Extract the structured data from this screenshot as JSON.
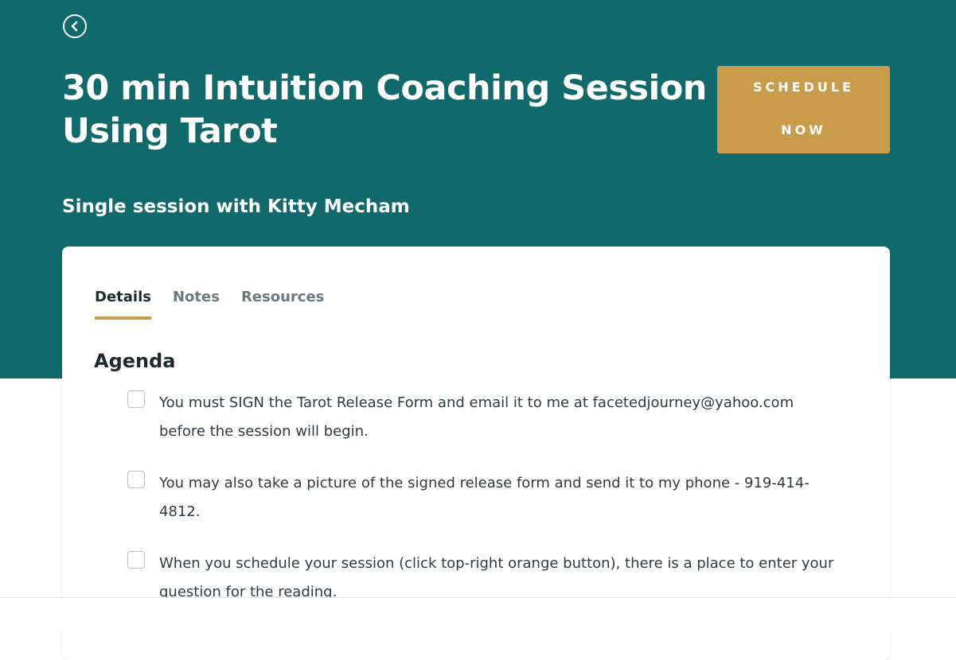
{
  "header": {
    "back_icon": "chevron-left-circle-icon",
    "title": "30 min Intuition Coaching Session Using Tarot",
    "schedule_button": {
      "line1": "SCHEDULE",
      "line2": "NOW"
    },
    "subtitle": "Single session with Kitty Mecham"
  },
  "tabs": [
    {
      "label": "Details",
      "active": true
    },
    {
      "label": "Notes",
      "active": false
    },
    {
      "label": "Resources",
      "active": false
    }
  ],
  "agenda": {
    "heading": "Agenda",
    "items": [
      {
        "text": "You must SIGN the Tarot Release Form and email it to me at facetedjourney@yahoo.com before the session will begin.",
        "checked": false
      },
      {
        "text": "You may also take a picture of the signed release form and send it to my phone - 919-414-4812.",
        "checked": false
      },
      {
        "text": "When you schedule your session (click top-right orange button), there is a place to enter your question for the reading.",
        "checked": false
      }
    ]
  },
  "colors": {
    "hero_background": "#106a6b",
    "accent": "#c99c4b",
    "text_dark": "#1d2b2f",
    "tab_inactive": "#6b7a80"
  }
}
